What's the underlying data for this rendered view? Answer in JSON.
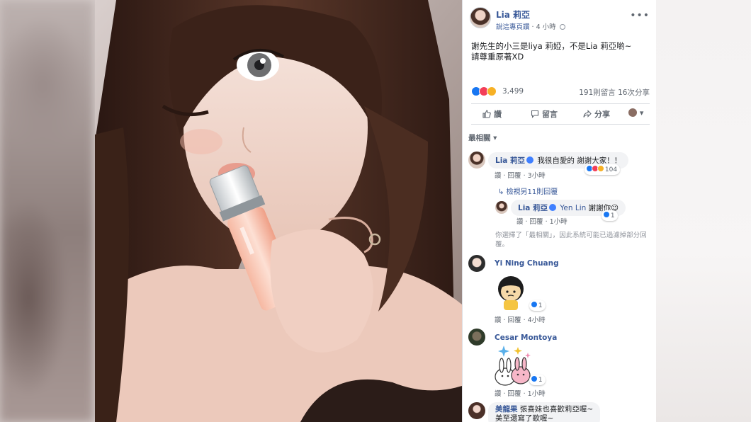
{
  "post": {
    "author": "Lia 莉亞",
    "meta_link": "說這專頁讚",
    "time": "4 小時",
    "text_line1": "謝先生的小三是liya 莉婭，不是Lia 莉亞喲~",
    "text_line2": "請尊重原著XD",
    "reaction_count": "3,499",
    "comments_shares": "191則留言  16次分享"
  },
  "actions": {
    "like": "讚",
    "comment": "留言",
    "share": "分享"
  },
  "sort_label": "最相關 ▾",
  "comments": [
    {
      "name": "Lia 莉亞",
      "text": "我很自愛的 謝謝大家！！",
      "reply_label": "讚 · 回覆 · 3小時",
      "reaction_count": "104",
      "view_more": "檢視另11則回覆",
      "reply": {
        "name": "Lia 莉亞",
        "mention": "Yen Lin",
        "text": "謝謝你😉",
        "links": "讚 · 回覆 · 1小時",
        "reaction_count": "1"
      },
      "note": "你選擇了「最相關」，因此系統可能已過濾掉部分回覆。"
    },
    {
      "name": "Yi Ning Chuang",
      "links": "讚 · 回覆 · 4小時",
      "reaction_count": "1"
    },
    {
      "name": "Cesar Montoya",
      "links": "讚 · 回覆 · 1小時",
      "reaction_count": "1"
    },
    {
      "name": "美龍果",
      "text": "張喜妹也喜歡莉亞喔~",
      "text_line2": "美至還寫了歌喔~"
    }
  ],
  "colors": {
    "link": "#385898",
    "like": "#1877f2",
    "love": "#f33e58",
    "haha": "#f7b125"
  }
}
